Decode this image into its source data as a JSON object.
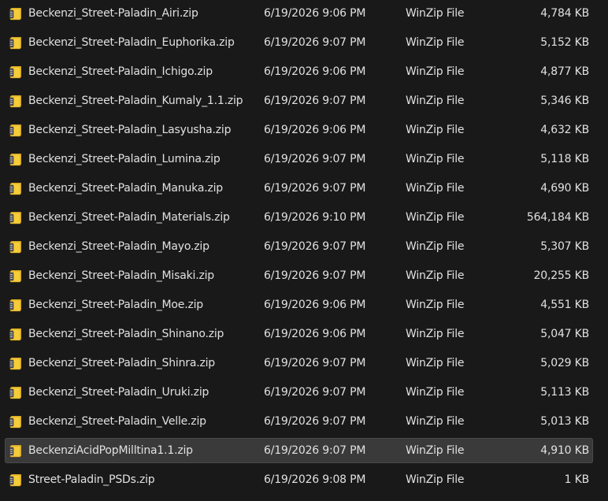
{
  "files": [
    {
      "name": "Beckenzi_Street-Paladin_Airi.zip",
      "date": "6/19/2026 9:06 PM",
      "type": "WinZip File",
      "size": "4,784 KB",
      "icon": "winzip-archive-icon"
    },
    {
      "name": "Beckenzi_Street-Paladin_Euphorika.zip",
      "date": "6/19/2026 9:07 PM",
      "type": "WinZip File",
      "size": "5,152 KB",
      "icon": "winzip-archive-icon"
    },
    {
      "name": "Beckenzi_Street-Paladin_Ichigo.zip",
      "date": "6/19/2026 9:06 PM",
      "type": "WinZip File",
      "size": "4,877 KB",
      "icon": "winzip-archive-icon"
    },
    {
      "name": "Beckenzi_Street-Paladin_Kumaly_1.1.zip",
      "date": "6/19/2026 9:07 PM",
      "type": "WinZip File",
      "size": "5,346 KB",
      "icon": "winzip-archive-icon"
    },
    {
      "name": "Beckenzi_Street-Paladin_Lasyusha.zip",
      "date": "6/19/2026 9:06 PM",
      "type": "WinZip File",
      "size": "4,632 KB",
      "icon": "winzip-archive-icon"
    },
    {
      "name": "Beckenzi_Street-Paladin_Lumina.zip",
      "date": "6/19/2026 9:07 PM",
      "type": "WinZip File",
      "size": "5,118 KB",
      "icon": "winzip-archive-icon"
    },
    {
      "name": "Beckenzi_Street-Paladin_Manuka.zip",
      "date": "6/19/2026 9:07 PM",
      "type": "WinZip File",
      "size": "4,690 KB",
      "icon": "winzip-archive-icon"
    },
    {
      "name": "Beckenzi_Street-Paladin_Materials.zip",
      "date": "6/19/2026 9:10 PM",
      "type": "WinZip File",
      "size": "564,184 KB",
      "icon": "winzip-archive-icon"
    },
    {
      "name": "Beckenzi_Street-Paladin_Mayo.zip",
      "date": "6/19/2026 9:07 PM",
      "type": "WinZip File",
      "size": "5,307 KB",
      "icon": "winzip-archive-icon"
    },
    {
      "name": "Beckenzi_Street-Paladin_Misaki.zip",
      "date": "6/19/2026 9:07 PM",
      "type": "WinZip File",
      "size": "20,255 KB",
      "icon": "winzip-archive-icon"
    },
    {
      "name": "Beckenzi_Street-Paladin_Moe.zip",
      "date": "6/19/2026 9:06 PM",
      "type": "WinZip File",
      "size": "4,551 KB",
      "icon": "winzip-archive-icon"
    },
    {
      "name": "Beckenzi_Street-Paladin_Shinano.zip",
      "date": "6/19/2026 9:06 PM",
      "type": "WinZip File",
      "size": "5,047 KB",
      "icon": "winzip-archive-icon"
    },
    {
      "name": "Beckenzi_Street-Paladin_Shinra.zip",
      "date": "6/19/2026 9:07 PM",
      "type": "WinZip File",
      "size": "5,029 KB",
      "icon": "winzip-archive-icon"
    },
    {
      "name": "Beckenzi_Street-Paladin_Uruki.zip",
      "date": "6/19/2026 9:07 PM",
      "type": "WinZip File",
      "size": "5,113 KB",
      "icon": "winzip-archive-icon"
    },
    {
      "name": "Beckenzi_Street-Paladin_Velle.zip",
      "date": "6/19/2026 9:07 PM",
      "type": "WinZip File",
      "size": "5,013 KB",
      "icon": "winzip-archive-icon"
    },
    {
      "name": "BeckenziAcidPopMilltina1.1.zip",
      "date": "6/19/2026 9:07 PM",
      "type": "WinZip File",
      "size": "4,910 KB",
      "icon": "winzip-archive-icon",
      "selected": true
    },
    {
      "name": "Street-Paladin_PSDs.zip",
      "date": "6/19/2026 9:08 PM",
      "type": "WinZip File",
      "size": "1 KB",
      "icon": "winzip-archive-icon"
    }
  ],
  "colors": {
    "background": "#191919",
    "text": "#e0e0e0",
    "selected_row": "#3a3a3a",
    "zip_icon_yellow": "#f2c230",
    "zip_icon_binding": "#5a5a5a"
  }
}
